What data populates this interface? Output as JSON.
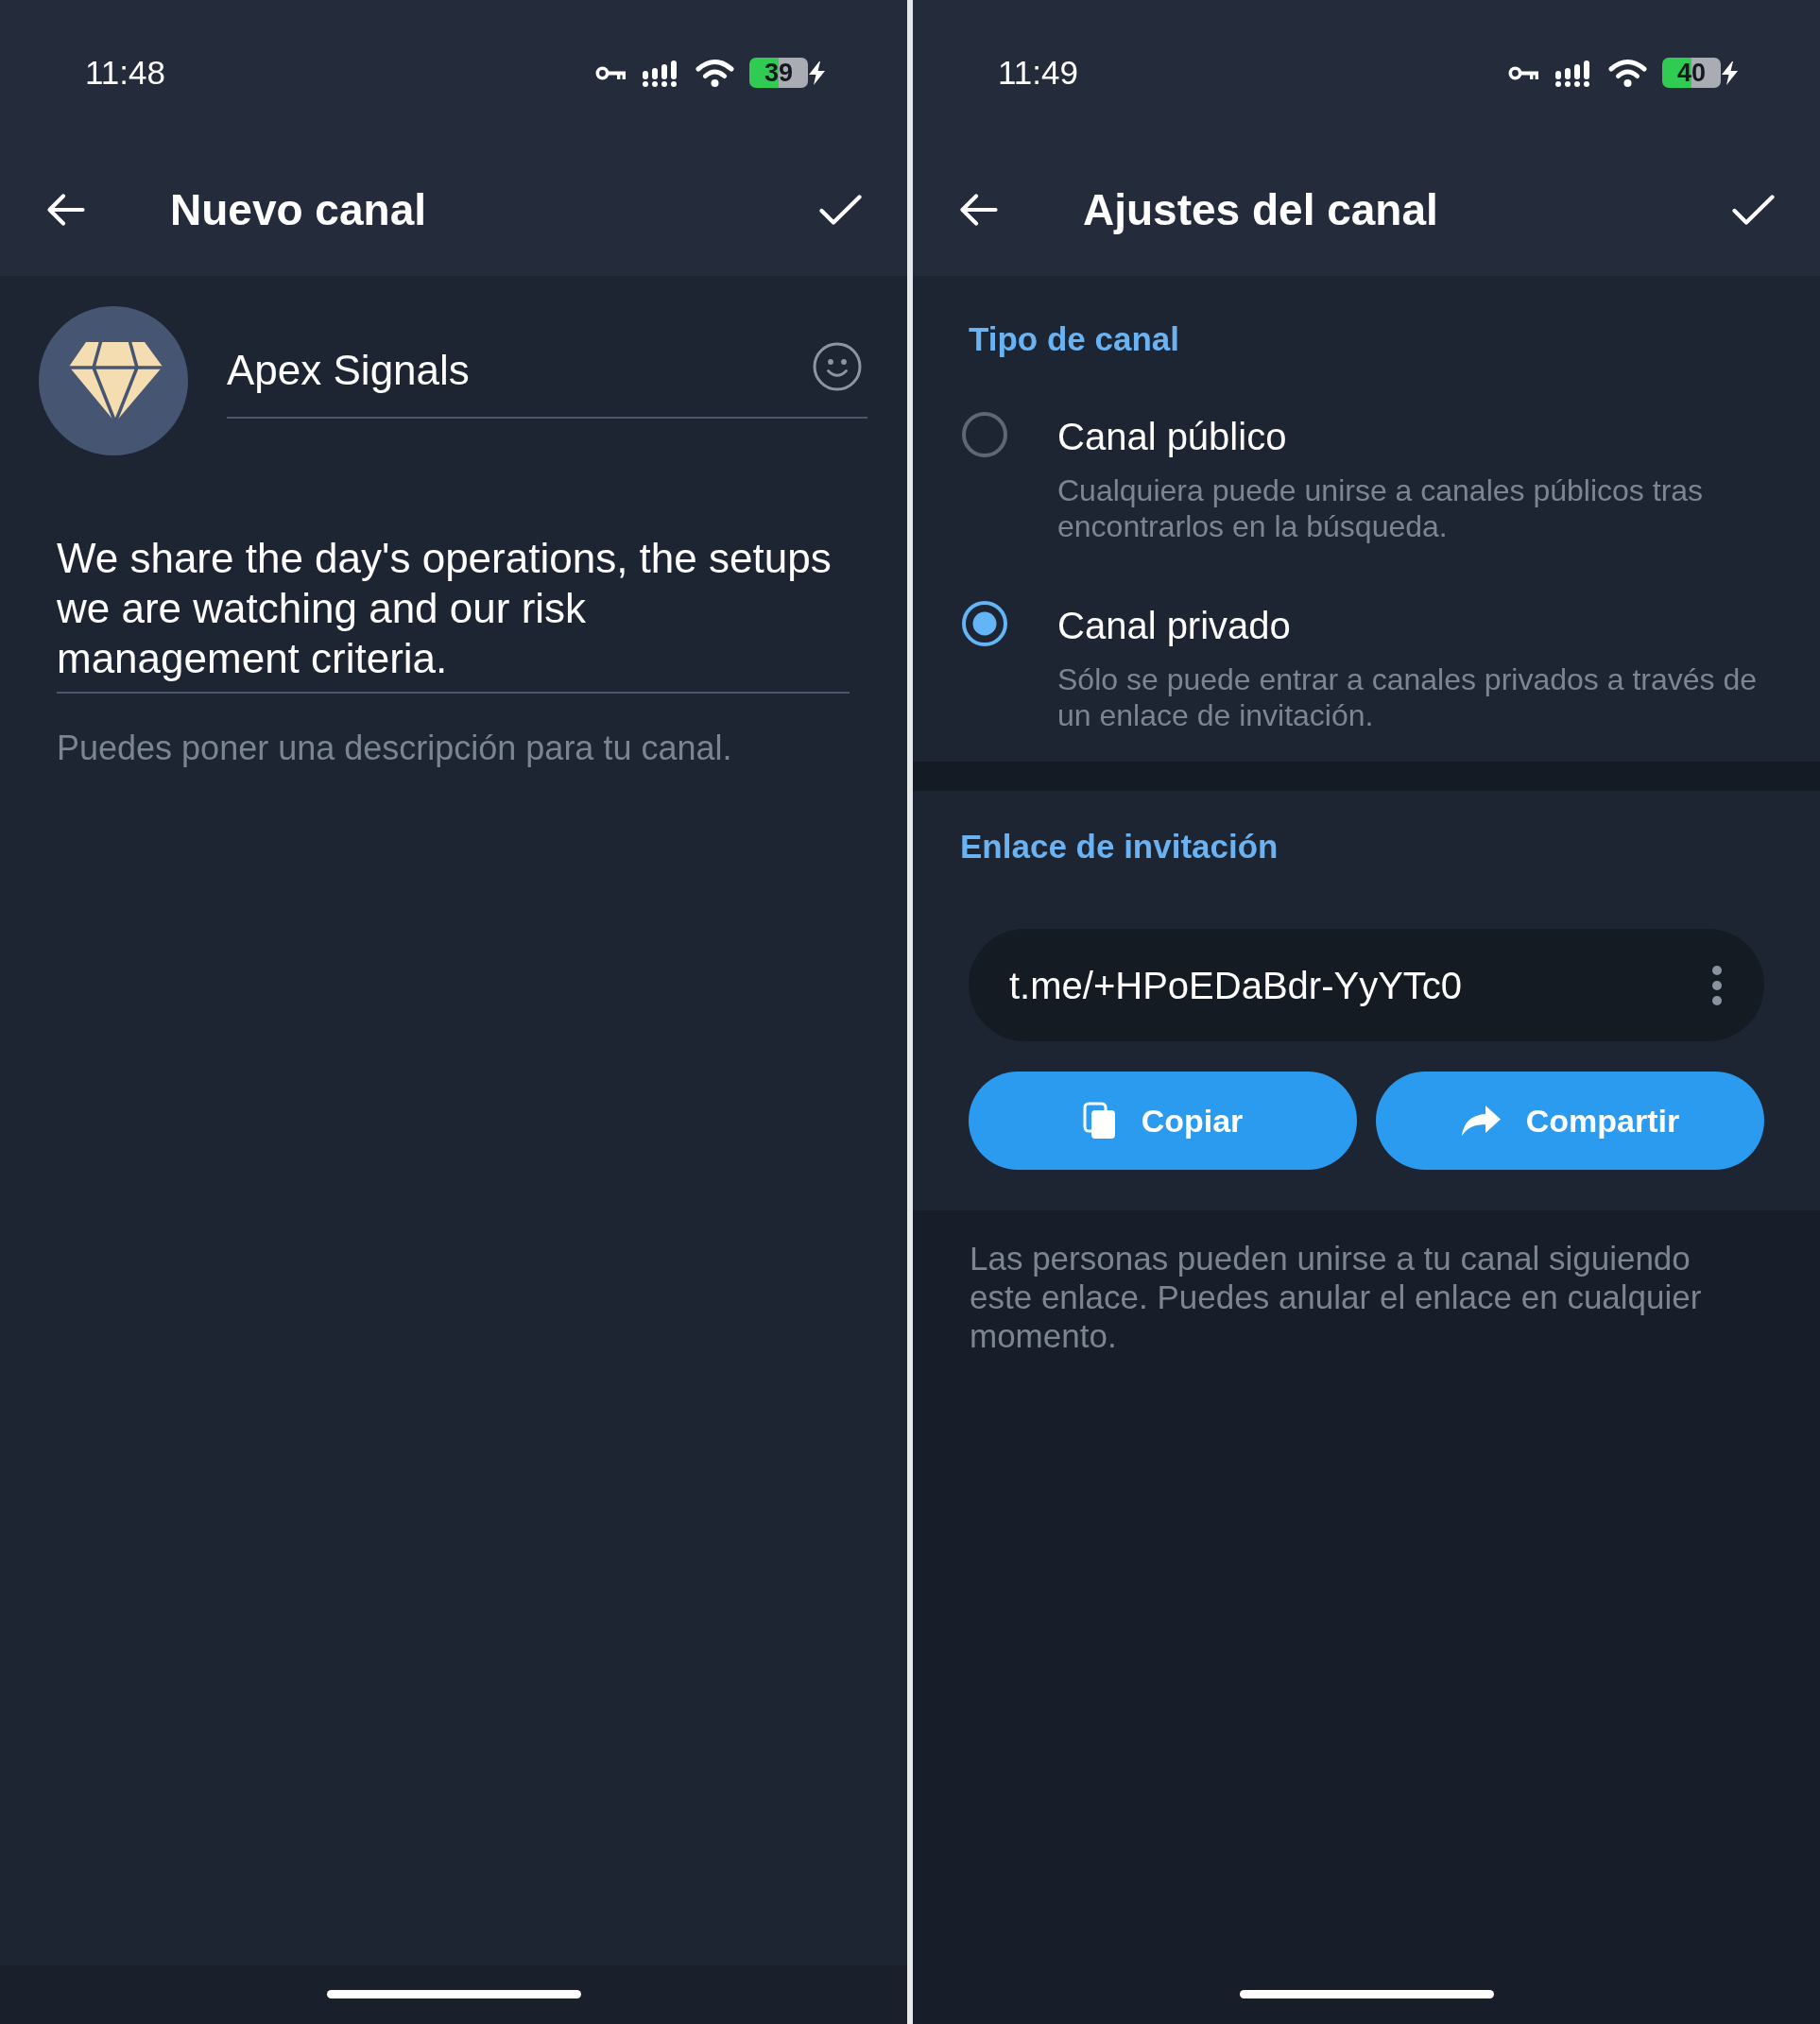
{
  "screens": [
    {
      "kind": "new_channel",
      "status_bar": {
        "time": "11:48",
        "battery": "39"
      },
      "app_bar": {
        "title": "Nuevo canal"
      },
      "name_field": {
        "value": "Apex Signals"
      },
      "description_field": {
        "value": "We share the day's operations, the setups we are watching and our risk management criteria."
      },
      "hint": "Puedes poner una descripción para tu canal."
    },
    {
      "kind": "channel_settings",
      "status_bar": {
        "time": "11:49",
        "battery": "40"
      },
      "app_bar": {
        "title": "Ajustes del canal"
      },
      "channel_type": {
        "heading": "Tipo de canal",
        "options": [
          {
            "label": "Canal público",
            "description": "Cualquiera puede unirse a canales públicos tras encontrarlos en la búsqueda.",
            "selected": false
          },
          {
            "label": "Canal privado",
            "description": "Sólo se puede entrar a canales privados a través de un enlace de invitación.",
            "selected": true
          }
        ]
      },
      "invite_link": {
        "heading": "Enlace de invitación",
        "link": "t.me/+HPoEDaBdr-YyYTc0",
        "buttons": [
          {
            "kind": "copy",
            "label": "Copiar"
          },
          {
            "kind": "share",
            "label": "Compartir"
          }
        ]
      },
      "footer_note": "Las personas pueden unirse a tu canal siguiendo este enlace. Puedes anular el enlace en cualquier momento."
    }
  ]
}
